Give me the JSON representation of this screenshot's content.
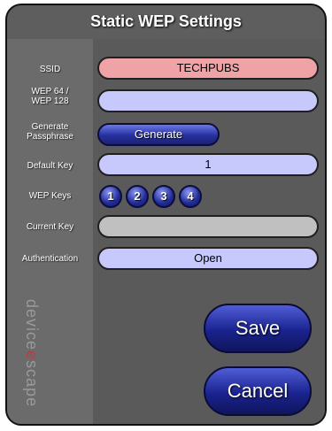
{
  "header": {
    "title": "Static WEP Settings"
  },
  "labels": {
    "ssid": "SSID",
    "wep_line1": "WEP 64 /",
    "wep_line2": "WEP 128",
    "generate_line1": "Generate",
    "generate_line2": "Passphrase",
    "default_key": "Default Key",
    "wep_keys": "WEP Keys",
    "current_key": "Current Key",
    "authentication": "Authentication"
  },
  "fields": {
    "ssid_value": "TECHPUBS",
    "wep_value": "",
    "default_key_value": "1",
    "current_key_value": "",
    "authentication_value": "Open"
  },
  "buttons": {
    "generate": "Generate",
    "key_1": "1",
    "key_2": "2",
    "key_3": "3",
    "key_4": "4",
    "save": "Save",
    "cancel": "Cancel"
  },
  "logo": {
    "part1": "device",
    "part2": "e",
    "part3": "scape"
  },
  "colors": {
    "ssid_field": "#f0a3a6",
    "input_field": "#c7c8fb",
    "disabled_field": "#c0c0c0",
    "button_blue": "#26309e",
    "logo_accent": "#cc3344"
  }
}
